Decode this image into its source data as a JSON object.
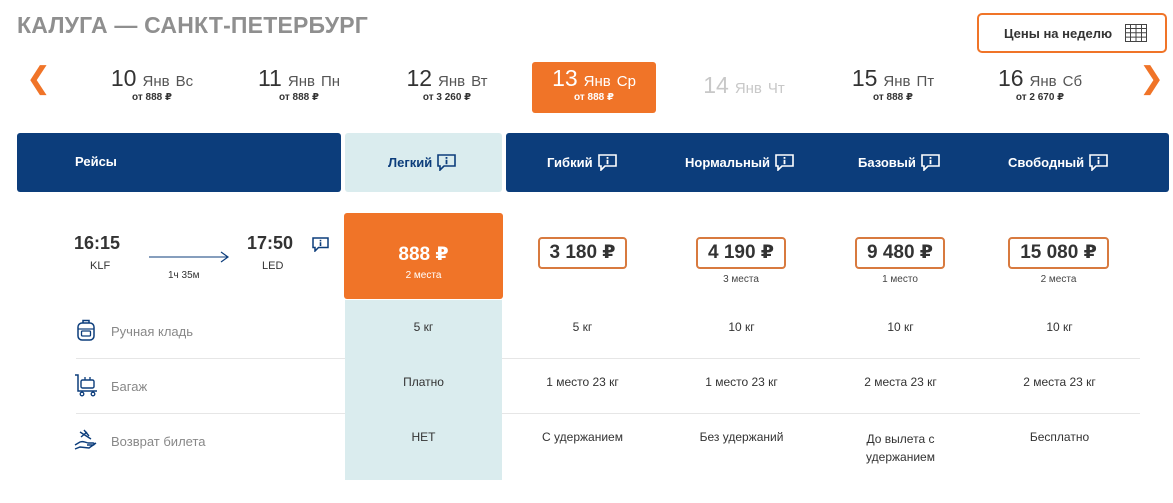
{
  "route": {
    "title": "КАЛУГА — САНКТ-ПЕТЕРБУРГ"
  },
  "week_button": {
    "label": "Цены на неделю",
    "icon": "calendar-grid-icon"
  },
  "nav": {
    "prev": "❮",
    "next": "❯"
  },
  "dates": [
    {
      "num": "10",
      "month": "Янв",
      "weekday": "Вс",
      "price": "от 888 ₽",
      "state": "normal"
    },
    {
      "num": "11",
      "month": "Янв",
      "weekday": "Пн",
      "price": "от 888 ₽",
      "state": "normal"
    },
    {
      "num": "12",
      "month": "Янв",
      "weekday": "Вт",
      "price": "от 3 260 ₽",
      "state": "normal"
    },
    {
      "num": "13",
      "month": "Янв",
      "weekday": "Ср",
      "price": "от 888 ₽",
      "state": "active"
    },
    {
      "num": "14",
      "month": "Янв",
      "weekday": "Чт",
      "price": "",
      "state": "disabled"
    },
    {
      "num": "15",
      "month": "Янв",
      "weekday": "Пт",
      "price": "от 888 ₽",
      "state": "normal"
    },
    {
      "num": "16",
      "month": "Янв",
      "weekday": "Сб",
      "price": "от 2 670 ₽",
      "state": "normal"
    }
  ],
  "table_header": {
    "flights": "Рейсы",
    "fares": [
      "Легкий",
      "Гибкий",
      "Нормальный",
      "Базовый",
      "Свободный"
    ]
  },
  "flight": {
    "dep_time": "16:15",
    "dep_code": "KLF",
    "arr_time": "17:50",
    "arr_code": "LED",
    "duration": "1ч 35м"
  },
  "prices": [
    {
      "value": "888 ₽",
      "seats": "2 места"
    },
    {
      "value": "3 180 ₽",
      "seats": ""
    },
    {
      "value": "4 190 ₽",
      "seats": "3 места"
    },
    {
      "value": "9 480 ₽",
      "seats": "1 место"
    },
    {
      "value": "15 080 ₽",
      "seats": "2 места"
    }
  ],
  "rows": [
    {
      "label": "Ручная кладь",
      "icon": "backpack-icon",
      "values": [
        "5 кг",
        "5 кг",
        "10 кг",
        "10 кг",
        "10 кг"
      ]
    },
    {
      "label": "Багаж",
      "icon": "luggage-cart-icon",
      "values": [
        "Платно",
        "1 место 23 кг",
        "1 место 23 кг",
        "2 места 23 кг",
        "2 места 23 кг"
      ]
    },
    {
      "label": "Возврат билета",
      "icon": "refund-hand-icon",
      "values": [
        "НЕТ",
        "С удержанием",
        "Без удержаний",
        "До вылета с удержанием",
        "Бесплатно"
      ]
    }
  ],
  "colors": {
    "accent": "#f07428",
    "navy": "#0c3d7b",
    "light": "#daecee"
  }
}
